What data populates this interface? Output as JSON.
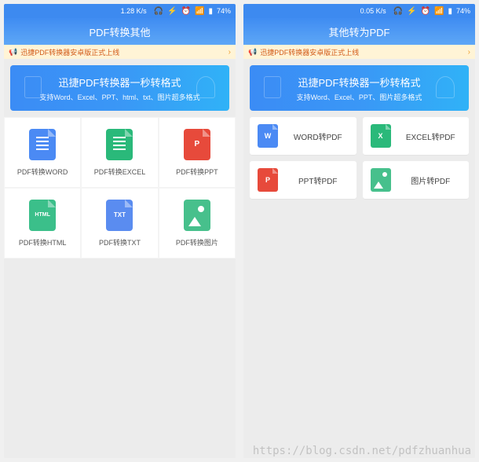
{
  "watermark": "https://blog.csdn.net/pdfzhuanhua",
  "left": {
    "status": {
      "speed": "1.28 K/s",
      "battery": "74%"
    },
    "header": "PDF转换其他",
    "notice": "迅捷PDF转换器安卓版正式上线",
    "hero_title": "迅捷PDF转换器一秒转格式",
    "hero_sub": "支持Word、Excel、PPT、html、txt、图片超多格式",
    "items": [
      {
        "label": "PDF转换WORD"
      },
      {
        "label": "PDF转换EXCEL"
      },
      {
        "label": "PDF转换PPT"
      },
      {
        "label": "PDF转换HTML"
      },
      {
        "label": "PDF转换TXT"
      },
      {
        "label": "PDF转换图片"
      }
    ]
  },
  "right": {
    "status": {
      "speed": "0.05 K/s",
      "battery": "74%"
    },
    "header": "其他转为PDF",
    "notice": "迅捷PDF转换器安卓版正式上线",
    "hero_title": "迅捷PDF转换器一秒转格式",
    "hero_sub": "支持Word、Excel、PPT、图片超多格式",
    "items": [
      {
        "label": "WORD转PDF"
      },
      {
        "label": "EXCEL转PDF"
      },
      {
        "label": "PPT转PDF"
      },
      {
        "label": "图片转PDF"
      }
    ]
  }
}
